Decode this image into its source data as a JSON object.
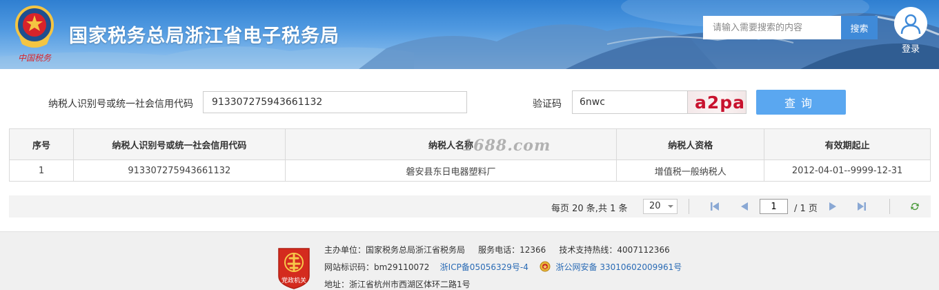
{
  "header": {
    "title": "国家税务总局浙江省电子税务局",
    "search_placeholder": "请输入需要搜索的内容",
    "search_button": "搜索",
    "login_label": "登录",
    "emblem_icon": "tax-emblem-icon",
    "emblem_caption": "中国税务"
  },
  "form": {
    "taxid_label": "纳税人识别号或统一社会信用代码",
    "taxid_value": "913307275943661132",
    "code_label": "验证码",
    "code_value": "6nwc",
    "captcha_text": "a2pa",
    "query_button": "查询"
  },
  "table": {
    "headers": [
      "序号",
      "纳税人识别号或统一社会信用代码",
      "纳税人名称",
      "纳税人资格",
      "有效期起止"
    ],
    "rows": [
      [
        "1",
        "913307275943661132",
        "磐安县东日电器塑料厂",
        "增值税一般纳税人",
        "2012-04-01--9999-12-31"
      ]
    ],
    "watermark": "1688.com"
  },
  "pager": {
    "info": "每页 20 条,共 1 条",
    "page_size": "20",
    "current_page": "1",
    "total_pages": "/ 1 页"
  },
  "footer": {
    "sponsor": "主办单位：国家税务总局浙江省税务局",
    "service_phone": "服务电话：12366",
    "support_hotline": "技术支持热线：4007112366",
    "site_id": "网站标识码：bm29110072",
    "icp": "浙ICP备05056329号-4",
    "police_record": "浙公网安备 33010602009961号",
    "address": "地址：浙江省杭州市西湖区体环二路1号",
    "badge_caption": "党政机关"
  },
  "colors": {
    "header_blue": "#2f7fd1",
    "search_button": "#3f8ad8",
    "query_button": "#5aa7f0",
    "captcha_red": "#c8122e",
    "link_blue": "#2a6bb5"
  }
}
